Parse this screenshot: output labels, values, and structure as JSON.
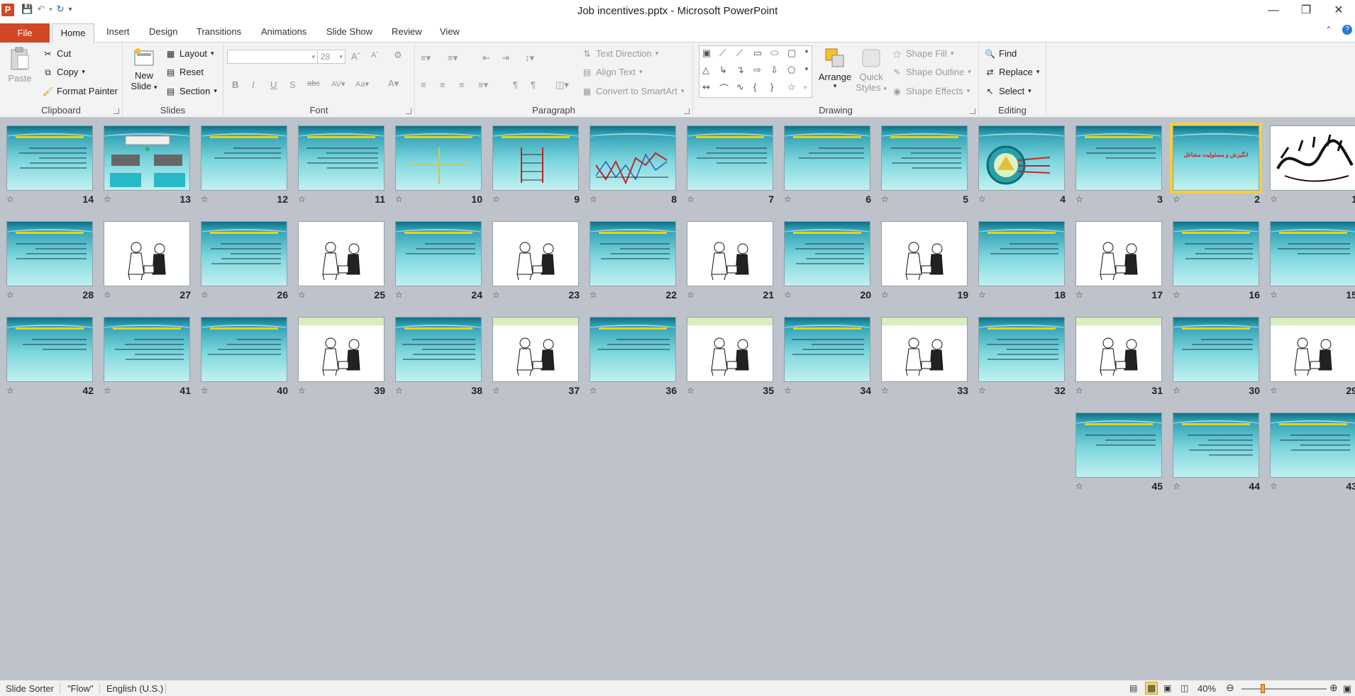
{
  "window": {
    "title": "Job incentives.pptx - Microsoft PowerPoint",
    "app_icon": "P",
    "controls": [
      "—",
      "❐",
      "✕"
    ]
  },
  "quick_access": {
    "save_icon": "save-icon",
    "undo_icon": "undo-icon",
    "redo_icon": "redo-icon"
  },
  "tabs": [
    "File",
    "Home",
    "Insert",
    "Design",
    "Transitions",
    "Animations",
    "Slide Show",
    "Review",
    "View"
  ],
  "ribbon": {
    "clipboard": {
      "label": "Clipboard",
      "paste": "Paste",
      "cut": "Cut",
      "copy": "Copy",
      "format_painter": "Format Painter"
    },
    "slides": {
      "label": "Slides",
      "new_slide_line1": "New",
      "new_slide_line2": "Slide",
      "layout": "Layout",
      "reset": "Reset",
      "section": "Section"
    },
    "font": {
      "label": "Font",
      "font_name": "",
      "font_size": "28"
    },
    "paragraph": {
      "label": "Paragraph",
      "text_direction": "Text Direction",
      "align_text": "Align Text",
      "convert_smartart": "Convert to SmartArt"
    },
    "drawing": {
      "label": "Drawing",
      "arrange": "Arrange",
      "quick_styles_line1": "Quick",
      "quick_styles_line2": "Styles",
      "shape_fill": "Shape Fill",
      "shape_outline": "Shape Outline",
      "shape_effects": "Shape Effects"
    },
    "editing": {
      "label": "Editing",
      "find": "Find",
      "replace": "Replace",
      "select": "Select"
    }
  },
  "slides": {
    "selected": 2,
    "numbers": [
      "1",
      "2",
      "3",
      "4",
      "5",
      "6",
      "7",
      "8",
      "9",
      "10",
      "11",
      "12",
      "13",
      "14",
      "15",
      "16",
      "17",
      "18",
      "19",
      "20",
      "21",
      "22",
      "23",
      "24",
      "25",
      "26",
      "27",
      "28",
      "29",
      "30",
      "31",
      "32",
      "33",
      "34",
      "35",
      "36",
      "37",
      "38",
      "39",
      "40",
      "41",
      "42",
      "43",
      "44",
      "45"
    ],
    "slide2_title": "انگیزش و مسئولیت مشاغل"
  },
  "statusbar": {
    "view": "Slide Sorter",
    "theme": "\"Flow\"",
    "language": "English (U.S.)",
    "zoom": "40%"
  }
}
